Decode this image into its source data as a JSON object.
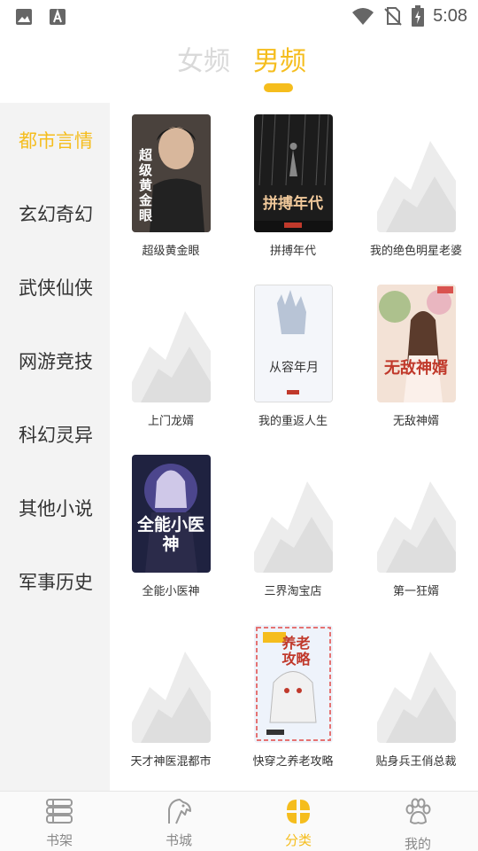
{
  "status_bar": {
    "time": "5:08",
    "left_icons": [
      "image-icon",
      "text-a-icon"
    ],
    "right_icons": [
      "wifi-icon",
      "no-sim-icon",
      "battery-icon"
    ]
  },
  "gender_tabs": [
    {
      "label": "女频",
      "active": false
    },
    {
      "label": "男频",
      "active": true
    }
  ],
  "categories": [
    {
      "label": "都市言情",
      "active": true
    },
    {
      "label": "玄幻奇幻",
      "active": false
    },
    {
      "label": "武侠仙侠",
      "active": false
    },
    {
      "label": "网游竞技",
      "active": false
    },
    {
      "label": "科幻灵异",
      "active": false
    },
    {
      "label": "其他小说",
      "active": false
    },
    {
      "label": "军事历史",
      "active": false
    }
  ],
  "books": [
    {
      "title": "超级黄金眼",
      "cover": "dark",
      "cover_text": "超级黄金眼"
    },
    {
      "title": "拼搏年代",
      "cover": "rain",
      "cover_text": "拼搏年代"
    },
    {
      "title": "我的绝色明星老婆",
      "cover": "placeholder",
      "cover_text": ""
    },
    {
      "title": "上门龙婿",
      "cover": "placeholder",
      "cover_text": ""
    },
    {
      "title": "我的重返人生",
      "cover": "light",
      "cover_text": "从容年月"
    },
    {
      "title": "无敌神婿",
      "cover": "floral",
      "cover_text": "无敌神婿"
    },
    {
      "title": "全能小医神",
      "cover": "anime",
      "cover_text": "全能小医神"
    },
    {
      "title": "三界淘宝店",
      "cover": "placeholder",
      "cover_text": ""
    },
    {
      "title": "第一狂婿",
      "cover": "placeholder",
      "cover_text": ""
    },
    {
      "title": "天才神医混都市",
      "cover": "placeholder",
      "cover_text": ""
    },
    {
      "title": "快穿之养老攻略",
      "cover": "cartoon",
      "cover_text": "养老攻略"
    },
    {
      "title": "贴身兵王俏总裁",
      "cover": "placeholder",
      "cover_text": ""
    }
  ],
  "bottom_nav": [
    {
      "label": "书架",
      "icon": "bookshelf-icon",
      "active": false
    },
    {
      "label": "书城",
      "icon": "bookstore-icon",
      "active": false
    },
    {
      "label": "分类",
      "icon": "category-icon",
      "active": true
    },
    {
      "label": "我的",
      "icon": "paw-icon",
      "active": false
    }
  ],
  "colors": {
    "accent": "#f5bd1d",
    "sidebar_bg": "#f3f3f3",
    "inactive": "#888888"
  }
}
